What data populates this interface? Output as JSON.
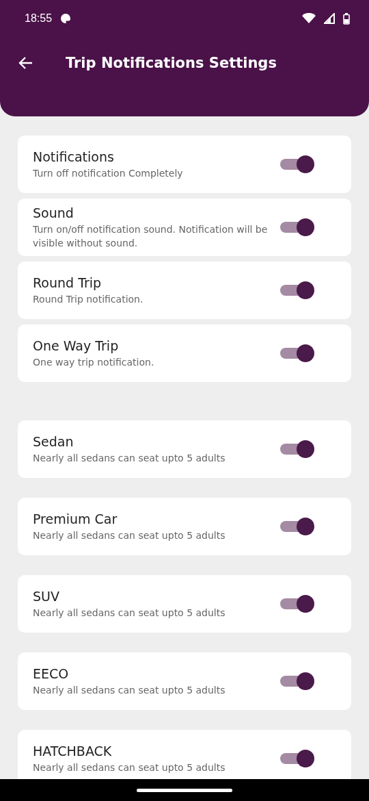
{
  "status_bar": {
    "time": "18:55"
  },
  "header": {
    "title": "Trip Notifications Settings"
  },
  "trip_settings": [
    {
      "title": "Notifications",
      "subtitle": "Turn off notification Completely",
      "on": true
    },
    {
      "title": "Sound",
      "subtitle": "Turn on/off notification sound. Notification will be visible without sound.",
      "on": true
    },
    {
      "title": "Round Trip",
      "subtitle": "Round Trip notification.",
      "on": true
    },
    {
      "title": "One Way Trip",
      "subtitle": "One way trip notification.",
      "on": true
    }
  ],
  "vehicle_types": [
    {
      "title": "Sedan",
      "subtitle": "Nearly all sedans can seat upto 5 adults",
      "on": true
    },
    {
      "title": "Premium Car",
      "subtitle": "Nearly all sedans can seat upto 5 adults",
      "on": true
    },
    {
      "title": "SUV",
      "subtitle": "Nearly all sedans can seat upto 5 adults",
      "on": true
    },
    {
      "title": "EECO",
      "subtitle": "Nearly all sedans can seat upto 5 adults",
      "on": true
    },
    {
      "title": "HATCHBACK",
      "subtitle": "Nearly all sedans can seat upto 5 adults",
      "on": true
    }
  ]
}
